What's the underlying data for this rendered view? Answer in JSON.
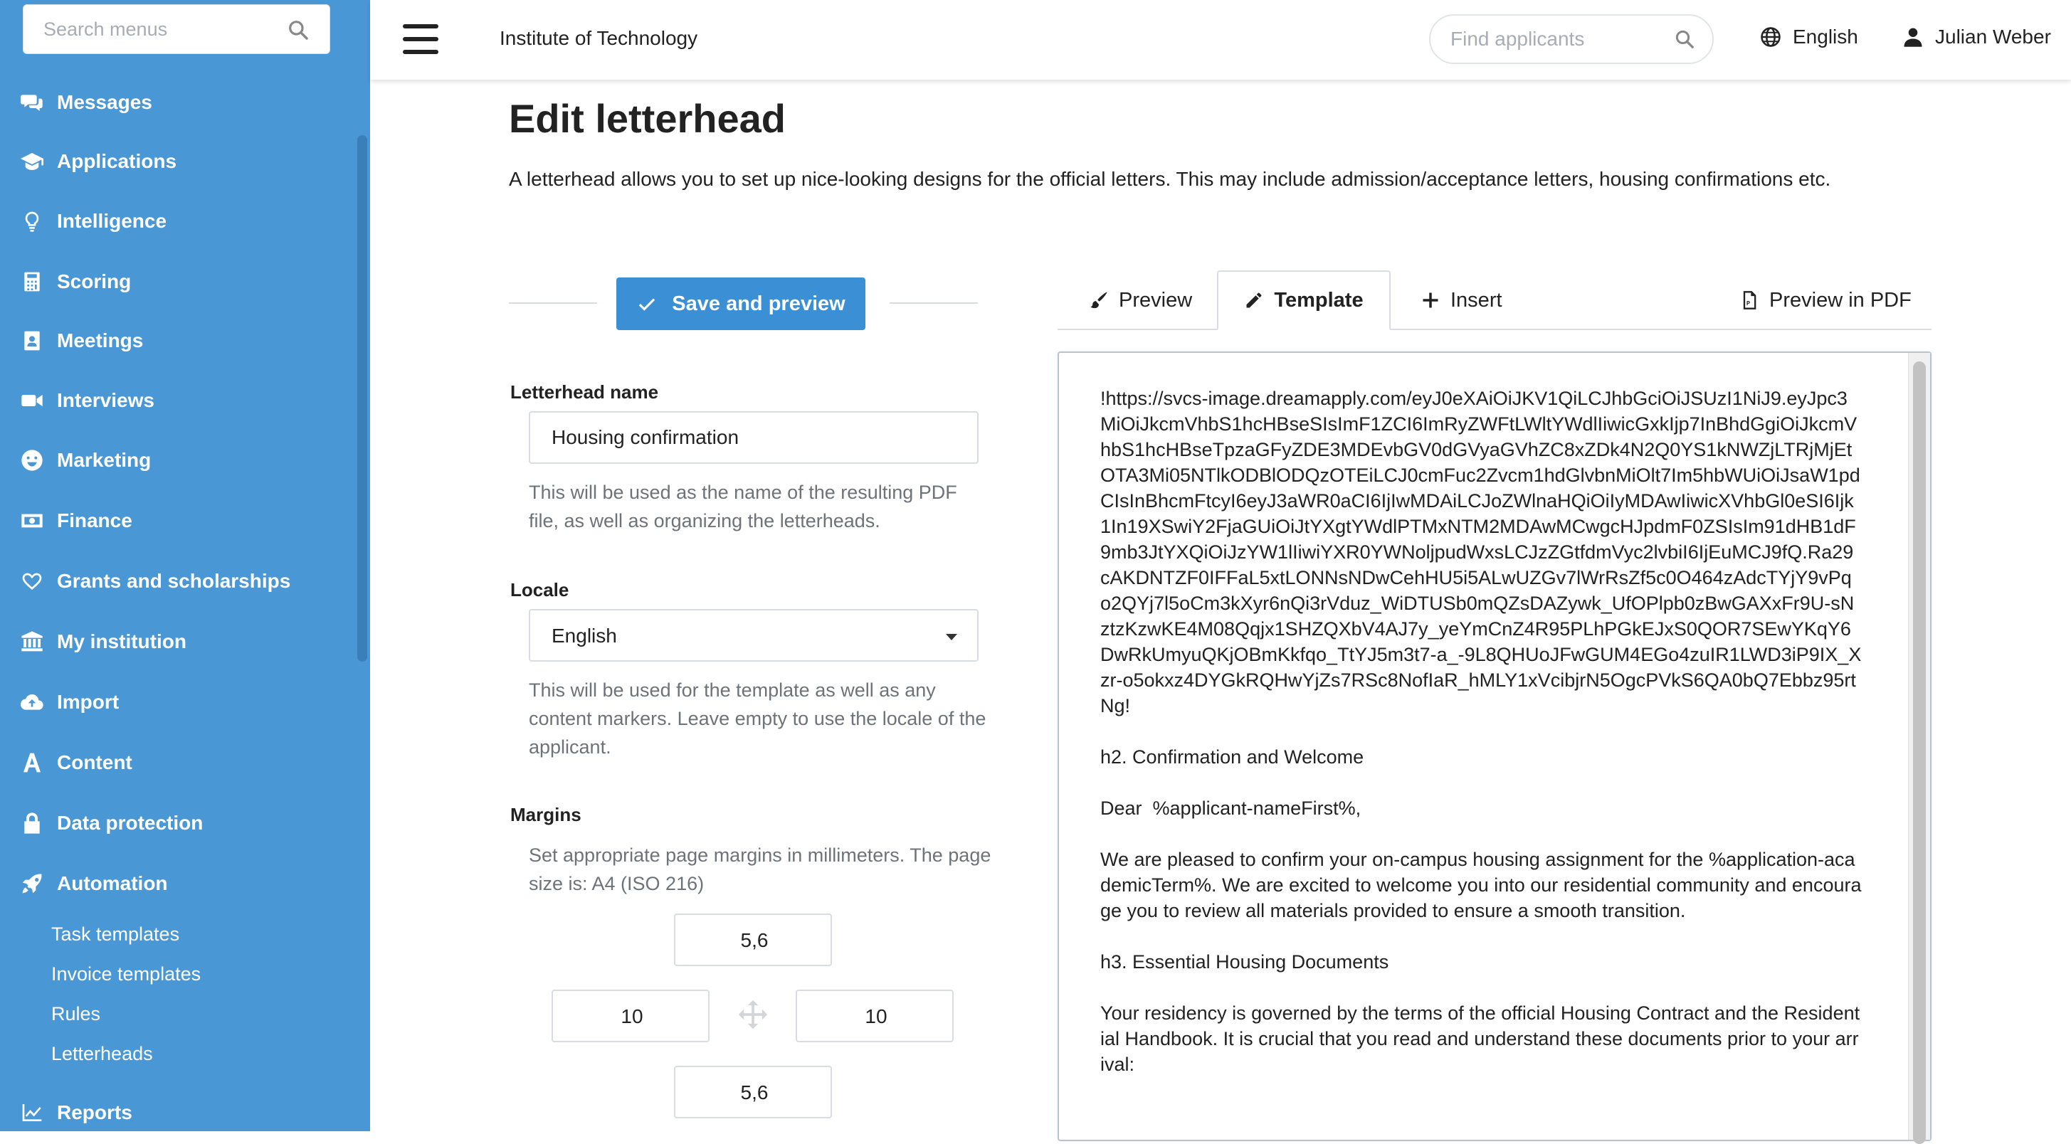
{
  "sidebar": {
    "search_placeholder": "Search menus",
    "items": [
      {
        "label": "Messages",
        "icon": "comments-icon"
      },
      {
        "label": "Applications",
        "icon": "graduation-cap-icon"
      },
      {
        "label": "Intelligence",
        "icon": "lightbulb-icon"
      },
      {
        "label": "Scoring",
        "icon": "calculator-icon"
      },
      {
        "label": "Meetings",
        "icon": "address-book-icon"
      },
      {
        "label": "Interviews",
        "icon": "video-camera-icon"
      },
      {
        "label": "Marketing",
        "icon": "smile-icon"
      },
      {
        "label": "Finance",
        "icon": "money-bill-icon"
      },
      {
        "label": "Grants and scholarships",
        "icon": "heart-icon"
      },
      {
        "label": "My institution",
        "icon": "institution-icon"
      },
      {
        "label": "Import",
        "icon": "cloud-upload-icon"
      },
      {
        "label": "Content",
        "icon": "font-icon"
      },
      {
        "label": "Data protection",
        "icon": "lock-icon"
      },
      {
        "label": "Automation",
        "icon": "rocket-icon"
      }
    ],
    "automation_sub": [
      "Task templates",
      "Invoice templates",
      "Rules",
      "Letterheads"
    ],
    "reports": {
      "label": "Reports",
      "icon": "line-chart-icon"
    }
  },
  "topbar": {
    "org_name": "Institute of Technology",
    "search_placeholder": "Find applicants",
    "language": "English",
    "user_name": "Julian Weber"
  },
  "page": {
    "title": "Edit letterhead",
    "description": "A letterhead allows you to set up nice-looking designs for the official letters. This may include admission/acceptance letters, housing confirmations etc."
  },
  "form": {
    "save_button": "Save and preview",
    "name_label": "Letterhead name",
    "name_value": "Housing confirmation",
    "name_help": "This will be used as the name of the resulting PDF file, as well as organizing the letterheads.",
    "locale_label": "Locale",
    "locale_value": "English",
    "locale_help": "This will be used for the template as well as any content markers. Leave empty to use the locale of the applicant.",
    "margins_label": "Margins",
    "margins_help": "Set appropriate page margins in millimeters. The page size is: A4 (ISO 216)",
    "margins": {
      "top": "5,6",
      "left": "10",
      "right": "10",
      "bottom": "5,6"
    }
  },
  "tabs": {
    "preview": "Preview",
    "template": "Template",
    "insert": "Insert",
    "preview_pdf": "Preview in PDF"
  },
  "editor": {
    "content": "!https://svcs-image.dreamapply.com/eyJ0eXAiOiJKV1QiLCJhbGciOiJSUzI1NiJ9.eyJpc3MiOiJkcmVhbS1hcHBseSIsImF1ZCI6ImRyZWFtLWltYWdlIiwicGxkIjp7InBhdGgiOiJkcmVhbS1hcHBseTpzaGFyZDE3MDEvbGV0dGVyaGVhZC8xZDk4N2Q0YS1kNWZjLTRjMjEtOTA3Mi05NTlkODBlODQzOTEiLCJ0cmFuc2Zvcm1hdGlvbnMiOlt7Im5hbWUiOiJsaW1pdCIsInBhcmFtcyI6eyJ3aWR0aCI6IjIwMDAiLCJoZWlnaHQiOiIyMDAwIiwicXVhbGl0eSI6Ijk1In19XSwiY2FjaGUiOiJtYXgtYWdlPTMxNTM2MDAwMCwgcHJpdmF0ZSIsIm91dHB1dF9mb3JtYXQiOiJzYW1lIiwiYXR0YWNoljpudWxsLCJzZGtfdmVyc2lvbiI6IjEuMCJ9fQ.Ra29cAKDNTZF0IFFaL5xtLONNsNDwCehHU5i5ALwUZGv7lWrRsZf5c0O464zAdcTYjY9vPqo2QYj7l5oCm3kXyr6nQi3rVduz_WiDTUSb0mQZsDAZywk_UfOPlpb0zBwGAXxFr9U-sNztzKzwKE4M08Qqjx1SHZQXbV4AJ7y_yeYmCnZ4R95PLhPGkEJxS0QOR7SEwYKqY6DwRkUmyuQKjOBmKkfqo_TtYJ5m3t7-a_-9L8QHUoJFwGUM4EGo4zuIR1LWD3iP9IX_Xzr-o5okxz4DYGkRQHwYjZs7RSc8NofIaR_hMLY1xVcibjrN5OgcPVkS6QA0bQ7Ebbz95rtNg!\n\nh2. Confirmation and Welcome\n\nDear  %applicant-nameFirst%,\n\nWe are pleased to confirm your on-campus housing assignment for the %application-academicTerm%. We are excited to welcome you into our residential community and encourage you to review all materials provided to ensure a smooth transition.\n\nh3. Essential Housing Documents\n\nYour residency is governed by the terms of the official Housing Contract and the Residential Handbook. It is crucial that you read and understand these documents prior to your arrival:"
  },
  "colors": {
    "sidebar_bg": "#4a97d6",
    "primary": "#3b8fd4"
  }
}
